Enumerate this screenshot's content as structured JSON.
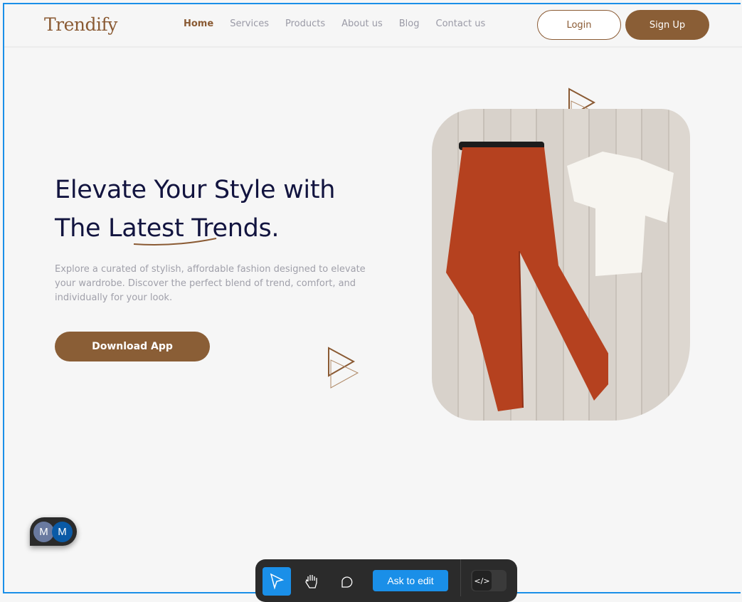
{
  "header": {
    "logo": "Trendify",
    "nav": [
      "Home",
      "Services",
      "Products",
      "About us",
      "Blog",
      "Contact us"
    ],
    "active_nav": "Home",
    "login_label": "Login",
    "signup_label": "Sign Up"
  },
  "hero": {
    "title_line1": "Elevate Your Style with",
    "title_line2": "The Latest Trends.",
    "description": "Explore a curated of stylish, affordable fashion designed to elevate your wardrobe. Discover the perfect blend of trend, comfort, and individually for your look.",
    "cta_label": "Download App",
    "image_icon": "fashion-flatlay-photo"
  },
  "colors": {
    "brand": "#8a5e36",
    "heading": "#12143f",
    "accent": "#1a8fe8"
  },
  "collaborators": [
    "M",
    "M"
  ],
  "toolbar": {
    "ask_label": "Ask to edit",
    "code_label": "</>"
  }
}
